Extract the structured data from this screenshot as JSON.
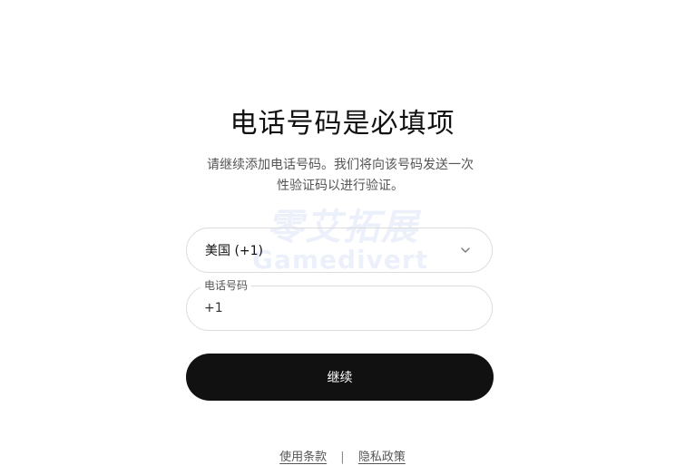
{
  "header": {
    "title": "电话号码是必填项",
    "subtitle_line1": "请继续添加电话号码。我们将向该号码发送一次",
    "subtitle_line2": "性验证码以进行验证。"
  },
  "watermark": {
    "text_cn": "零艾拓展",
    "text_en": "Gamedivert"
  },
  "form": {
    "country_select": {
      "selected": "美国 (+1)",
      "icon": "chevron-down-icon"
    },
    "phone": {
      "label": "电话号码",
      "value": "+1"
    },
    "continue_label": "继续"
  },
  "footer": {
    "terms_label": "使用条款",
    "separator": "|",
    "privacy_label": "隐私政策"
  },
  "colors": {
    "button_bg": "#111111",
    "button_text": "#ffffff",
    "border": "#dcdcdc",
    "muted_text": "#555555"
  }
}
